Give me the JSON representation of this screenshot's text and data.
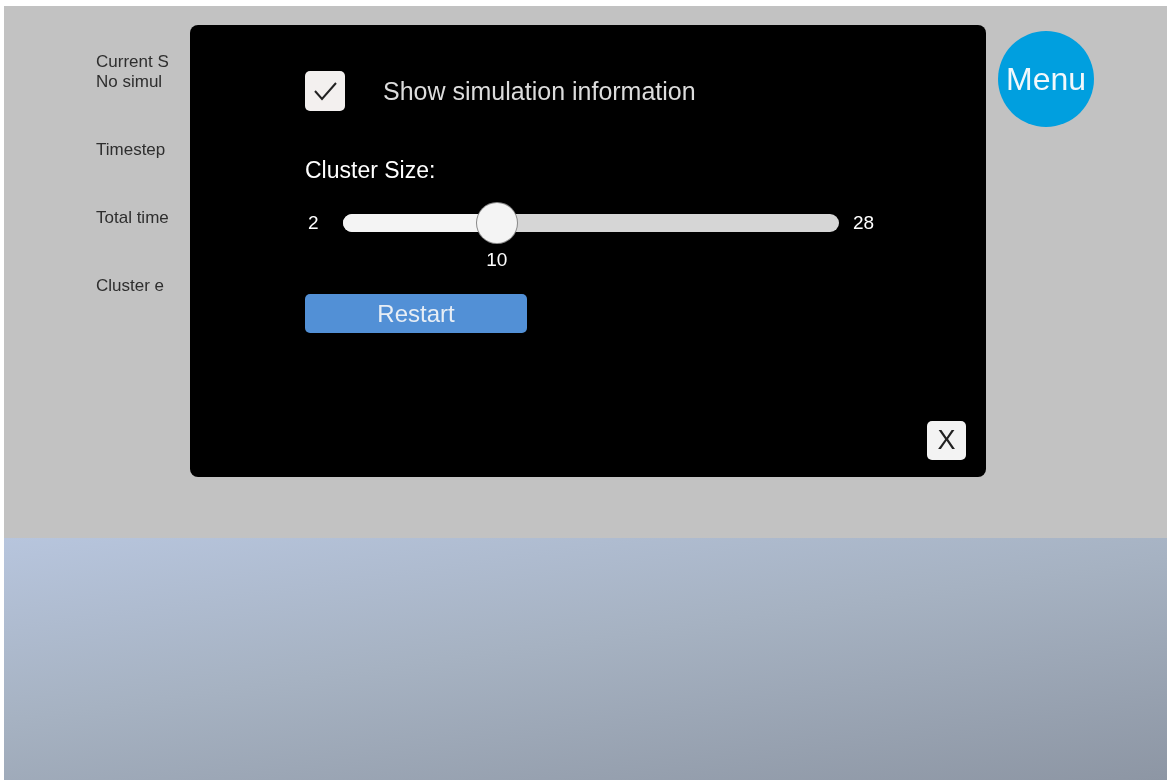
{
  "background_info": {
    "lines": [
      "Current S",
      "No simul"
    ],
    "labels": [
      "Timestep",
      "Total time",
      "Cluster e"
    ]
  },
  "menu_button": {
    "label": "Menu"
  },
  "dialog": {
    "checkbox": {
      "label": "Show simulation information",
      "checked": true
    },
    "slider": {
      "title": "Cluster Size:",
      "min": "2",
      "max": "28",
      "value": "10",
      "level": 0.31
    },
    "restart_button": {
      "label": "Restart"
    },
    "close_button": {
      "label": "X"
    }
  }
}
